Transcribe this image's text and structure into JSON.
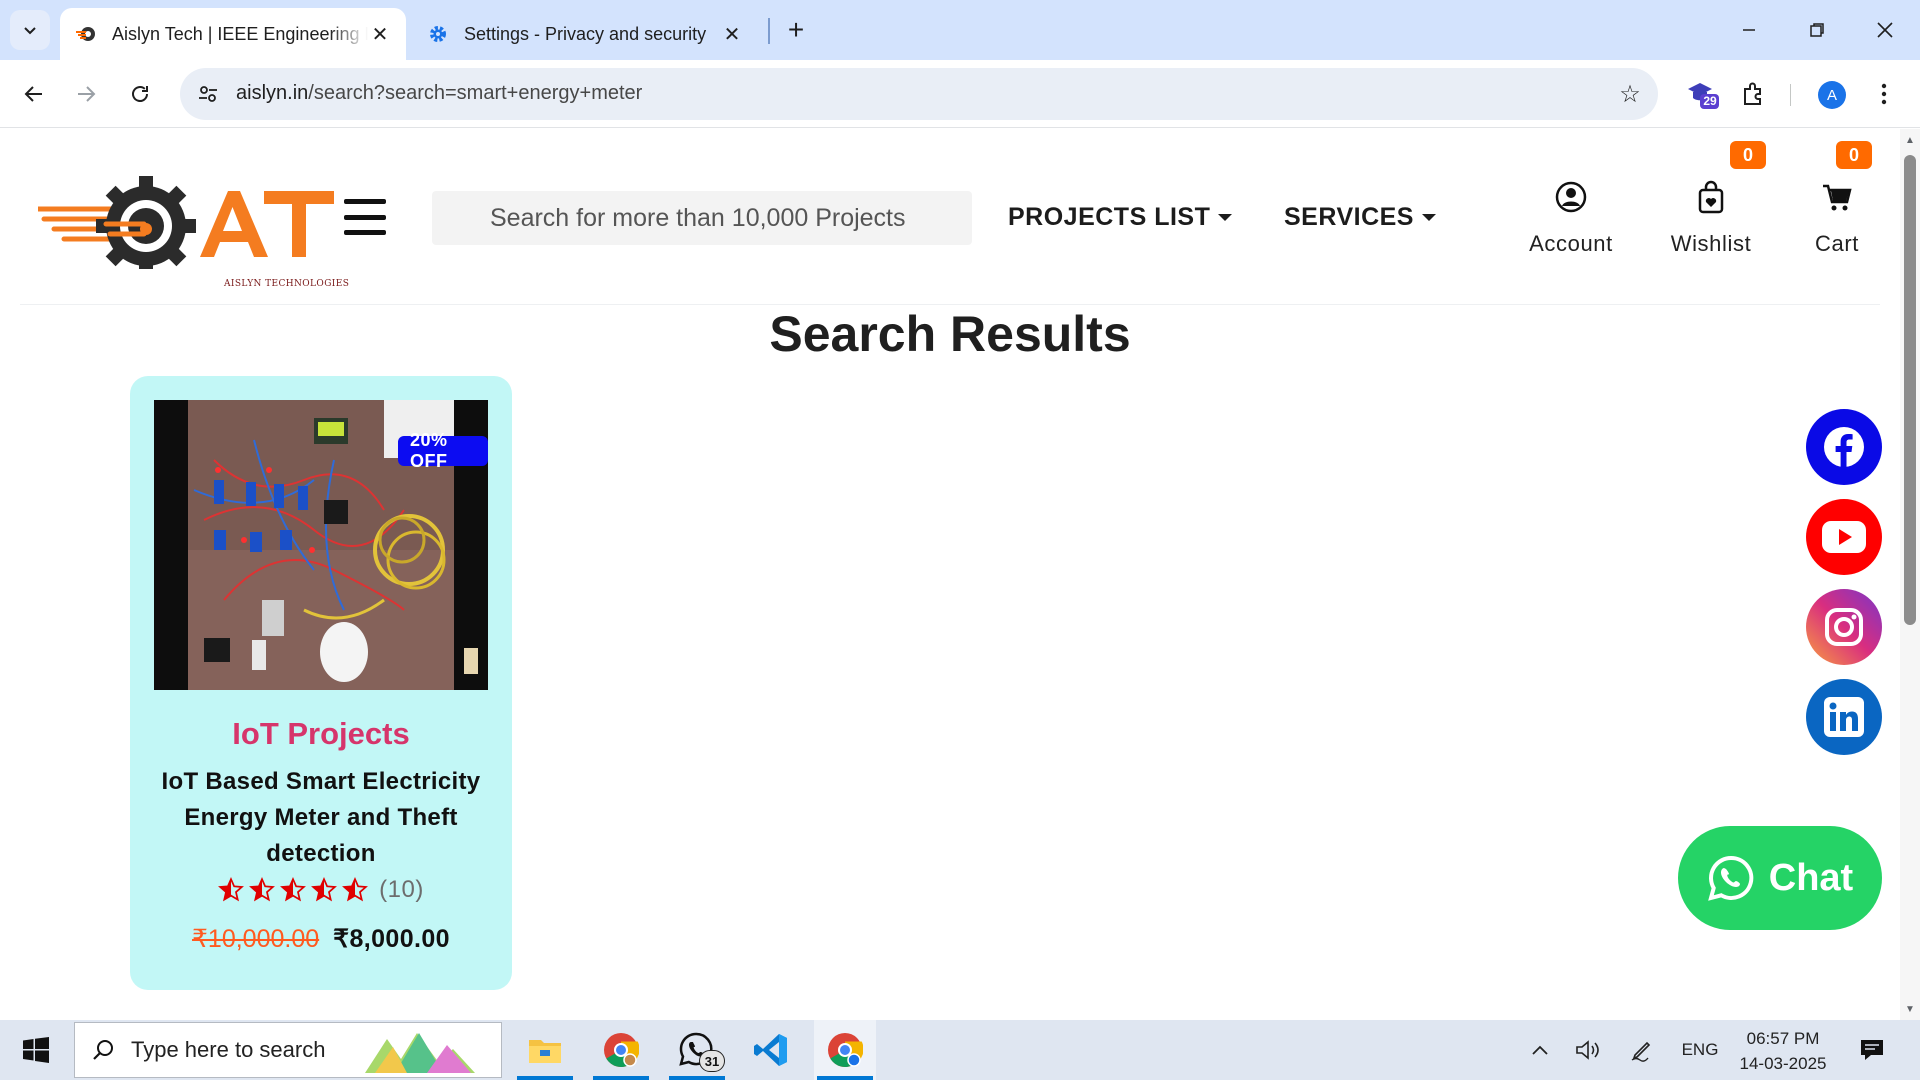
{
  "browser": {
    "tabs": [
      {
        "title": "Aislyn Tech | IEEE Engineering Projects",
        "active": true
      },
      {
        "title": "Settings - Privacy and security",
        "active": false
      }
    ],
    "url_domain": "aislyn.in",
    "url_path": "/search?search=smart+energy+meter",
    "extension_badge": "29",
    "profile_initial": "A"
  },
  "header": {
    "logo_text": "AT",
    "logo_subtitle": "AISLYN TECHNOLOGIES",
    "search_placeholder": "Search for more than 10,000 Projects",
    "menu": [
      "PROJECTS LIST",
      "SERVICES"
    ],
    "actions": {
      "account": "Account",
      "wishlist": "Wishlist",
      "wishlist_count": "0",
      "cart": "Cart",
      "cart_count": "0"
    }
  },
  "results": {
    "title": "Search Results",
    "products": [
      {
        "discount": "20% OFF",
        "category": "IoT Projects",
        "title": "IoT Based Smart Electricity Energy Meter and Theft detection",
        "rating_count": "(10)",
        "rating_stars": 5,
        "old_price": "₹10,000.00",
        "new_price": "₹8,000.00"
      }
    ]
  },
  "social": [
    "facebook",
    "youtube",
    "instagram",
    "linkedin"
  ],
  "chat": {
    "label": "Chat"
  },
  "taskbar": {
    "search_placeholder": "Type here to search",
    "whatsapp_badge": "31",
    "language": "ENG",
    "time": "06:57 PM",
    "date": "14-03-2025"
  },
  "colors": {
    "tabbar": "#d3e3fd",
    "brand_orange": "#ff6a00",
    "card_bg": "#c2f7f6",
    "category_pink": "#d6356b",
    "discount_blue": "#0c0cf2",
    "facebook": "#0a0ae6",
    "youtube": "#ff0000",
    "linkedin": "#0a66c2",
    "whatsapp": "#25d366"
  }
}
